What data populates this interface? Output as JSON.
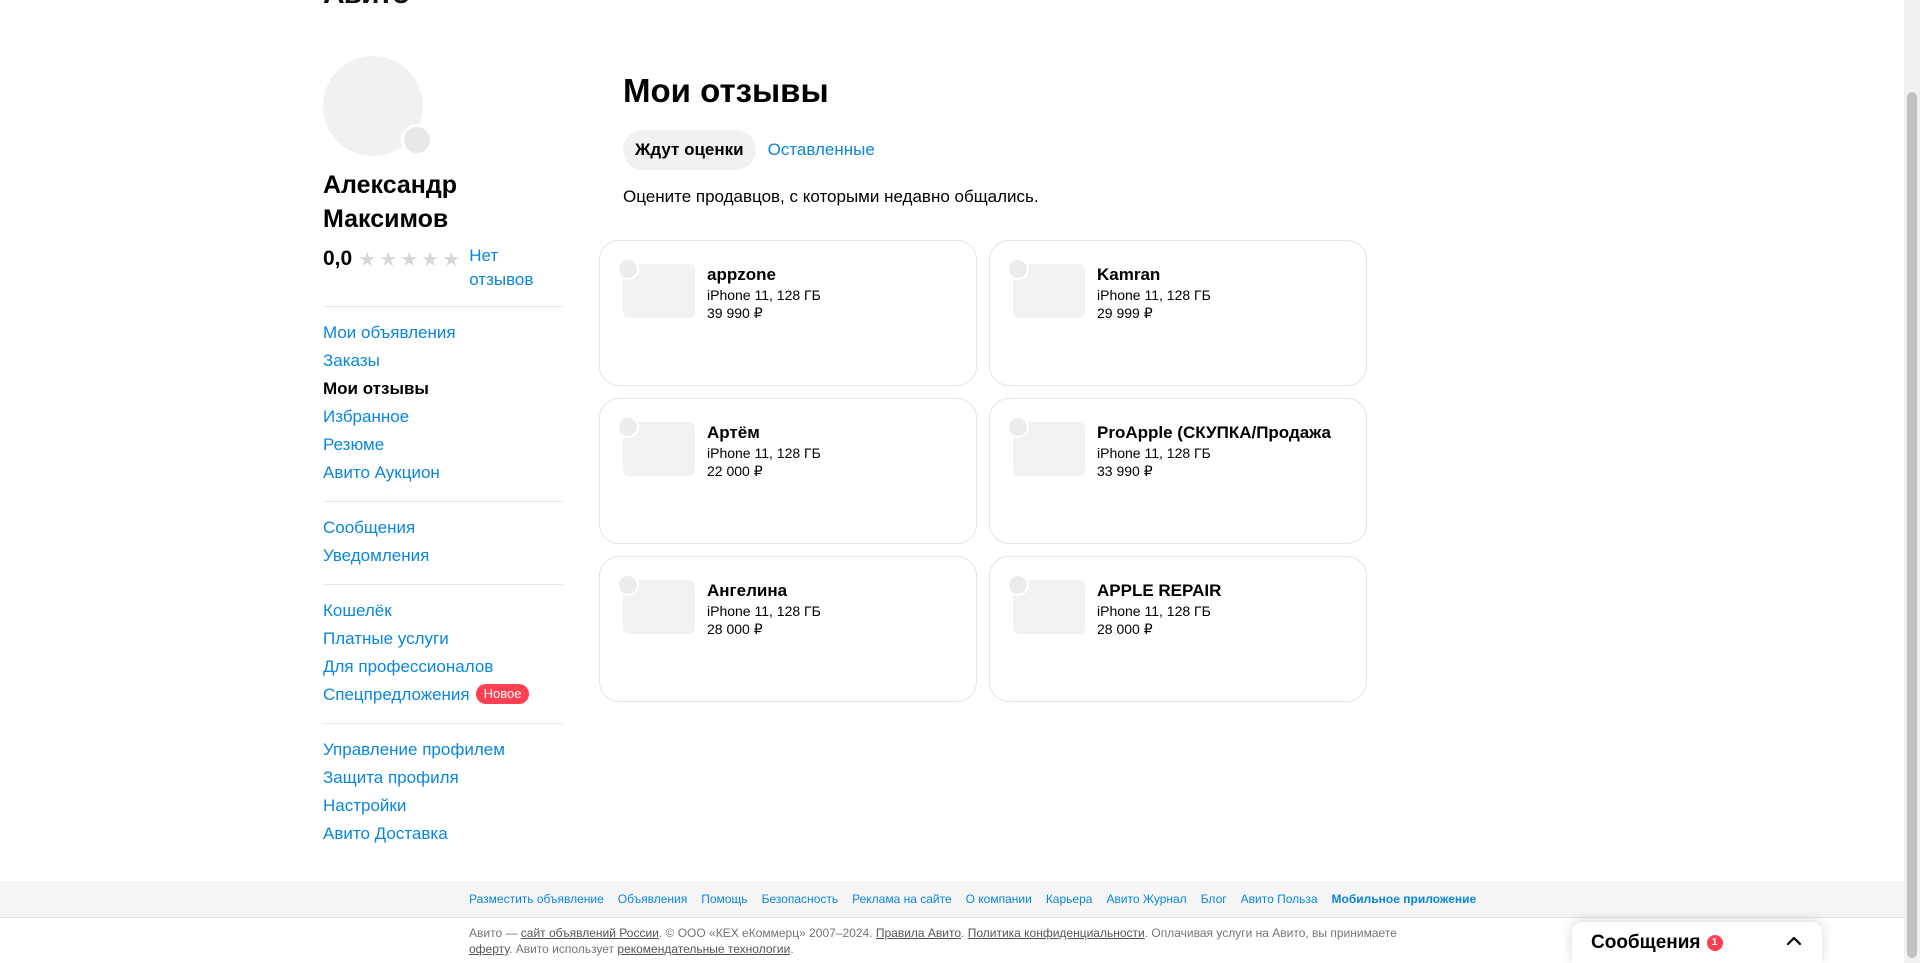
{
  "header": {
    "logo": "Авито"
  },
  "profile": {
    "name": "Александр Максимов",
    "rating": "0,0",
    "stars": [
      "★",
      "★",
      "★",
      "★",
      "★"
    ],
    "no_reviews_label": "Нет отзывов"
  },
  "sidebar": {
    "group1": [
      {
        "label": "Мои объявления",
        "active": false
      },
      {
        "label": "Заказы",
        "active": false
      },
      {
        "label": "Мои отзывы",
        "active": true
      },
      {
        "label": "Избранное",
        "active": false
      },
      {
        "label": "Резюме",
        "active": false
      },
      {
        "label": "Авито Аукцион",
        "active": false
      }
    ],
    "group2": [
      {
        "label": "Сообщения"
      },
      {
        "label": "Уведомления"
      }
    ],
    "group3": [
      {
        "label": "Кошелёк"
      },
      {
        "label": "Платные услуги"
      },
      {
        "label": "Для профессионалов"
      },
      {
        "label": "Спецпредложения",
        "badge": "Новое"
      }
    ],
    "group4": [
      {
        "label": "Управление профилем"
      },
      {
        "label": "Защита профиля"
      },
      {
        "label": "Настройки"
      },
      {
        "label": "Авито Доставка"
      }
    ]
  },
  "main": {
    "title": "Мои отзывы",
    "tabs": [
      {
        "label": "Ждут оценки",
        "active": true
      },
      {
        "label": "Оставленные",
        "active": false
      }
    ],
    "subtitle": "Оцените продавцов, с которыми недавно общались."
  },
  "cards": [
    {
      "seller": "appzone",
      "item": "iPhone 11, 128 ГБ",
      "price": "39 990 ₽"
    },
    {
      "seller": "Kamran",
      "item": "iPhone 11, 128 ГБ",
      "price": "29 999 ₽"
    },
    {
      "seller": "Артём",
      "item": "iPhone 11, 128 ГБ",
      "price": "22 000 ₽"
    },
    {
      "seller": "ProApple (СКУПКА/Продажа",
      "item": "iPhone 11, 128 ГБ",
      "price": "33 990 ₽"
    },
    {
      "seller": "Ангелина",
      "item": "iPhone 11, 128 ГБ",
      "price": "28 000 ₽"
    },
    {
      "seller": "APPLE REPAIR",
      "item": "iPhone 11, 128 ГБ",
      "price": "28 000 ₽"
    }
  ],
  "footer": {
    "links": [
      {
        "label": "Разместить объявление",
        "bold": false
      },
      {
        "label": "Объявления",
        "bold": false
      },
      {
        "label": "Помощь",
        "bold": false
      },
      {
        "label": "Безопасность",
        "bold": false
      },
      {
        "label": "Реклама на сайте",
        "bold": false
      },
      {
        "label": "О компании",
        "bold": false
      },
      {
        "label": "Карьера",
        "bold": false
      },
      {
        "label": "Авито Журнал",
        "bold": false
      },
      {
        "label": "Блог",
        "bold": false
      },
      {
        "label": "Авито Польза",
        "bold": false
      },
      {
        "label": "Мобильное приложение",
        "bold": true
      }
    ],
    "legal_1": "Авито — ",
    "legal_link_site": "сайт объявлений России",
    "legal_2": ". © ООО «КЕХ еКоммерц» 2007–2024. ",
    "legal_link_rules": "Правила Авито",
    "legal_3": ". ",
    "legal_link_privacy": "Политика конфиденциальности",
    "legal_4": ". Оплачивая услуги на Авито, вы принимаете ",
    "legal_link_offer": "оферту",
    "legal_5": ". Авито использует ",
    "legal_link_tech": "рекомендательные технологии",
    "legal_6": "."
  },
  "messenger": {
    "label": "Сообщения",
    "count": "1"
  },
  "colors": {
    "link": "#0a86dc",
    "badge": "#ff4053",
    "card_border": "#e4e4e4",
    "placeholder": "#f2f1f0"
  }
}
